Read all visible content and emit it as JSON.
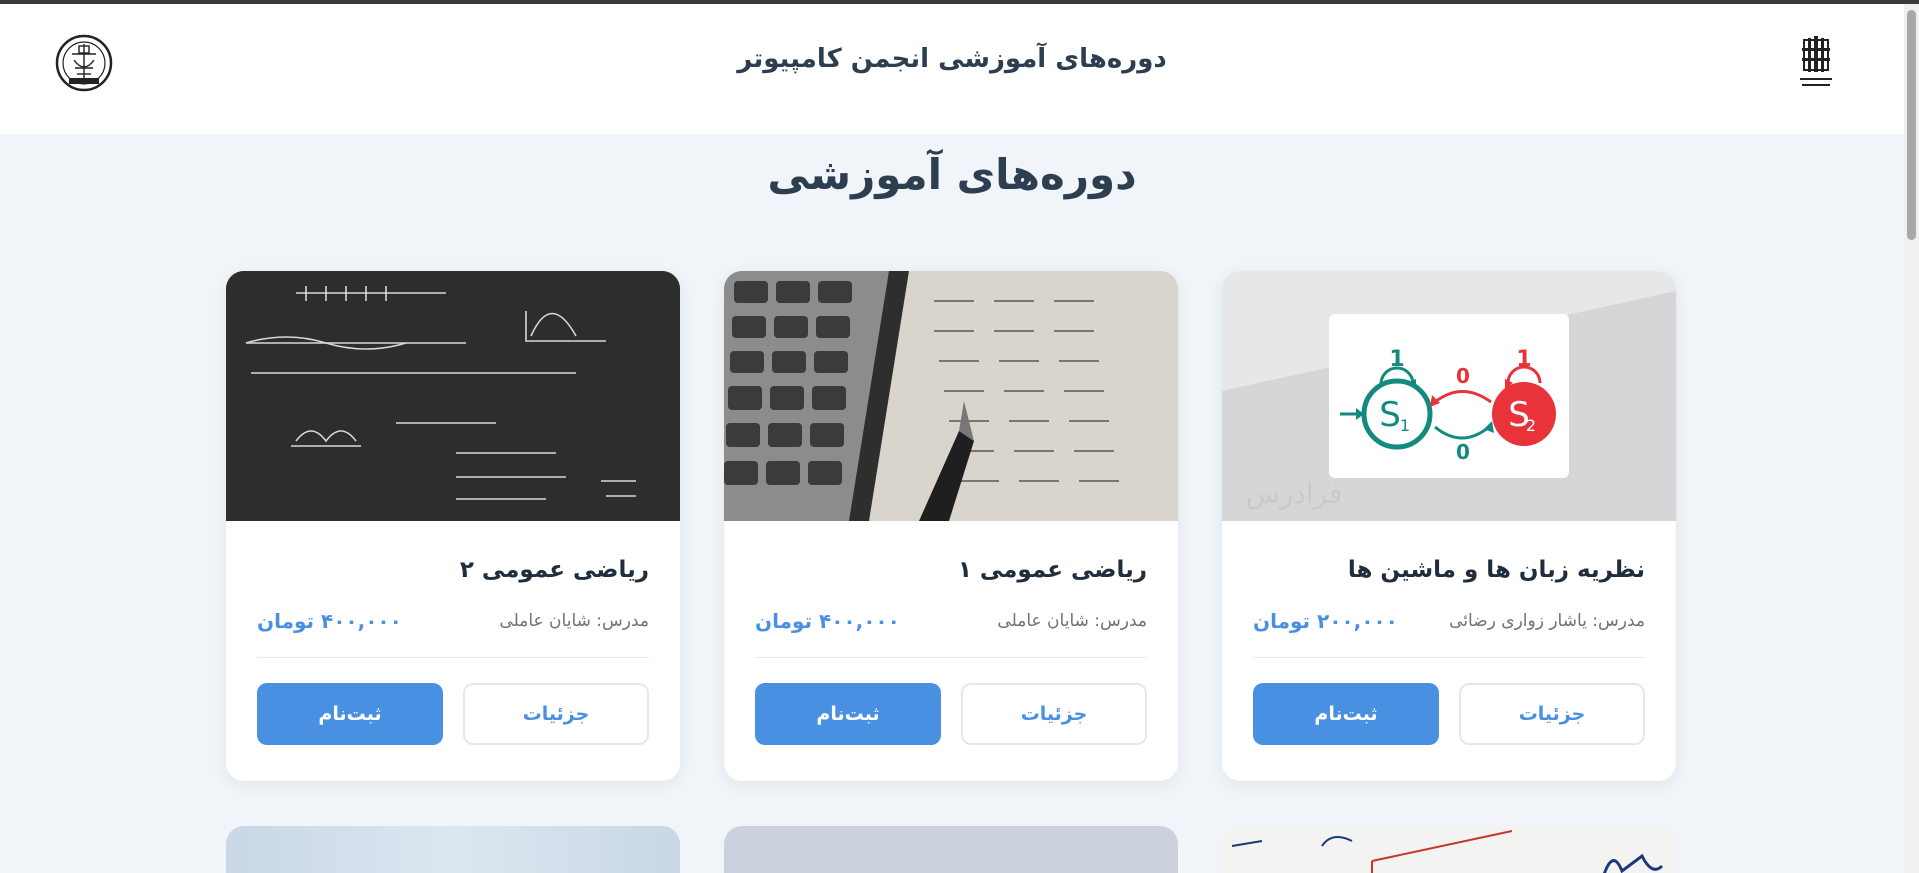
{
  "header": {
    "title": "دوره‌های آموزشی انجمن کامپیوتر"
  },
  "page": {
    "title": "دوره‌های آموزشی"
  },
  "courses": [
    {
      "title": "نظریه زبان ها و ماشین ها",
      "teacher": "مدرس: یاشار زواری رضائی",
      "price": "۲۰۰,۰۰۰ تومان",
      "details_label": "جزئیات",
      "register_label": "ثبت‌نام",
      "image": "automata-diagram",
      "watermark": "فرادرس"
    },
    {
      "title": "ریاضی عمومی ۱",
      "teacher": "مدرس: شایان عاملی",
      "price": "۴۰۰,۰۰۰ تومان",
      "details_label": "جزئیات",
      "register_label": "ثبت‌نام",
      "image": "calculator-photo"
    },
    {
      "title": "ریاضی عمومی ۲",
      "teacher": "مدرس: شایان عاملی",
      "price": "۴۰۰,۰۰۰ تومان",
      "details_label": "جزئیات",
      "register_label": "ثبت‌نام",
      "image": "chalkboard-photo"
    }
  ],
  "diagram": {
    "s1": "S",
    "s1_sub": "1",
    "s2": "S",
    "s2_sub": "2",
    "loop1": "1",
    "loop2": "1",
    "edge_top": "0",
    "edge_bottom": "0"
  },
  "colors": {
    "accent": "#4a90e2",
    "background": "#f1f5f9",
    "teal": "#138a7e",
    "red": "#e8333a"
  }
}
